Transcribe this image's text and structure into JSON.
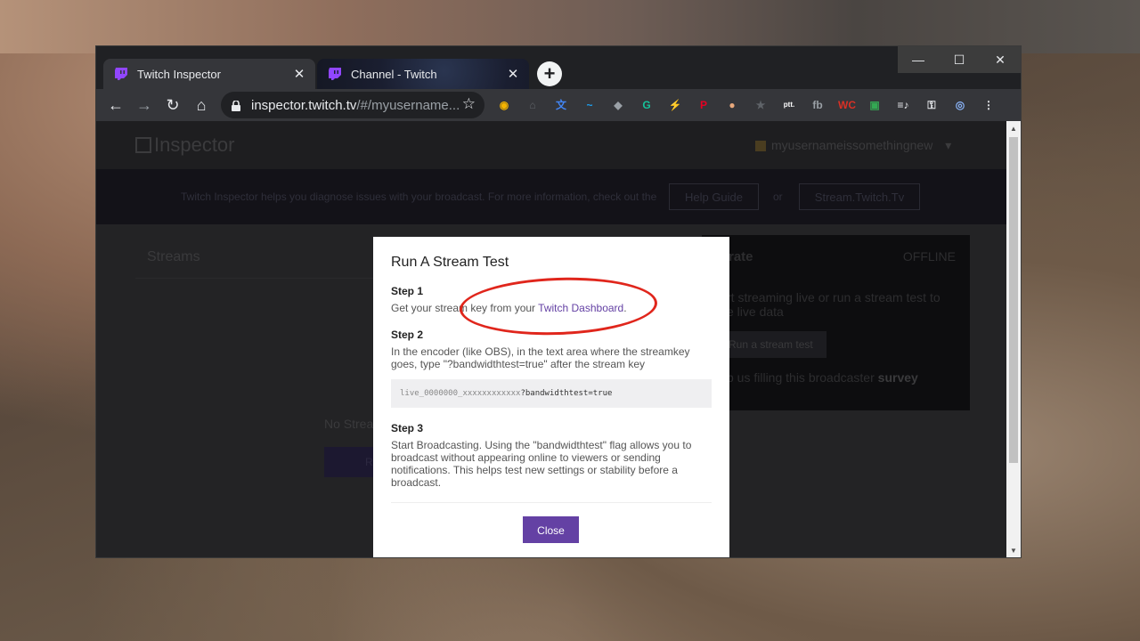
{
  "browser": {
    "tabs": [
      {
        "title": "Twitch Inspector",
        "active": true
      },
      {
        "title": "Channel - Twitch",
        "active": false
      }
    ],
    "new_tab": "+",
    "window_controls": {
      "minimize": "—",
      "maximize": "☐",
      "close": "✕"
    },
    "nav": {
      "back": "←",
      "forward": "→",
      "reload": "↻",
      "home": "⌂"
    },
    "url_host": "inspector.twitch.tv",
    "url_path": "/#/myusername...",
    "star": "☆",
    "extensions": [
      {
        "name": "chrome-ext-icon",
        "color": "#f4b400",
        "glyph": "◉"
      },
      {
        "name": "tools-ext-icon",
        "color": "#5f6368",
        "glyph": "⌂"
      },
      {
        "name": "translate-ext-icon",
        "color": "#4285f4",
        "glyph": "文"
      },
      {
        "name": "bird-ext-icon",
        "color": "#1da1f2",
        "glyph": "~"
      },
      {
        "name": "stamp-ext-icon",
        "color": "#9aa0a6",
        "glyph": "◆"
      },
      {
        "name": "grammarly-ext-icon",
        "color": "#15c39a",
        "glyph": "G"
      },
      {
        "name": "bolt-ext-icon",
        "color": "#5f6368",
        "glyph": "⚡"
      },
      {
        "name": "pinterest-ext-icon",
        "color": "#e60023",
        "glyph": "P"
      },
      {
        "name": "cookie-ext-icon",
        "color": "#e8a87c",
        "glyph": "●"
      },
      {
        "name": "star-ext-icon",
        "color": "#5f6368",
        "glyph": "★"
      },
      {
        "name": "ptt-ext-icon",
        "color": "#ffffff",
        "glyph": "ptt."
      },
      {
        "name": "fb-ext-icon",
        "color": "#9aa0a6",
        "glyph": "fb"
      },
      {
        "name": "wc-ext-icon",
        "color": "#d93025",
        "glyph": "WC"
      },
      {
        "name": "color-ext-icon",
        "color": "#34a853",
        "glyph": "▣"
      },
      {
        "name": "playlist-ext-icon",
        "color": "#e8eaed",
        "glyph": "≡♪"
      },
      {
        "name": "key-ext-icon",
        "color": "#e8eaed",
        "glyph": "⚿"
      },
      {
        "name": "profile-avatar-icon",
        "color": "#8ab4f8",
        "glyph": "◎"
      },
      {
        "name": "menu-dots-icon",
        "color": "#e8eaed",
        "glyph": "⋮"
      }
    ]
  },
  "inspector": {
    "logo": "Inspector",
    "username": "myusernameissomethingnew",
    "username_caret": "▾",
    "banner_text": "Twitch Inspector helps you diagnose issues with your broadcast. For more information, check out the",
    "help_guide": "Help Guide",
    "or": "or",
    "stream_twitch": "Stream.Twitch.Tv",
    "streams_title": "Streams",
    "no_streams": "No Strea",
    "run_btn_partial": "R",
    "bitrate_title": "rate",
    "offline": "OFFLINE",
    "bitrate_desc": "rt streaming live or run a stream test to\ne live data",
    "run_stream_test": "Run a stream test",
    "survey_text": "p us filling this broadcaster",
    "survey_bold": "survey"
  },
  "modal": {
    "title": "Run A Stream Test",
    "step1_heading": "Step 1",
    "step1_text": "Get your stream key from your",
    "step1_link": "Twitch Dashboard",
    "step1_end": ".",
    "step2_heading": "Step 2",
    "step2_text": "In the encoder (like OBS), in the text area where the streamkey goes, type \"?bandwidthtest=true\" after the stream key",
    "code_key": "live_0000000_xxxxxxxxxxxx",
    "code_suffix": "?bandwidthtest=true",
    "step3_heading": "Step 3",
    "step3_text": "Start Broadcasting. Using the \"bandwidthtest\" flag allows you to broadcast without appearing online to viewers or sending notifications. This helps test new settings or stability before a broadcast.",
    "close_label": "Close"
  },
  "colors": {
    "twitch_purple": "#6441a4",
    "annotation_red": "#e0261c"
  }
}
